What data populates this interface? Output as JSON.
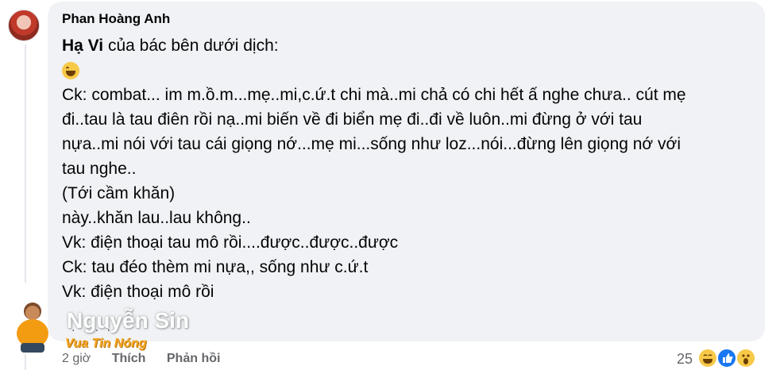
{
  "comment": {
    "author": "Phan Hoàng Anh",
    "mention": "Hạ Vi",
    "intro_rest": " của bác bên dưới dịch:",
    "emoji": "haha-emoji",
    "lines": [
      "Ck: combat... im m.ồ.m...mẹ..mi,c.ứ.t chi mà..mi chả có chi hết ấ nghe chưa.. cút mẹ",
      "đi..tau là tau điên rồi nạ..mi biến về đi biển mẹ đi..đi về luôn..mi đừng ở với tau",
      "nựa..mi nói với tau cái giọng nớ...mẹ mi...sống như loz...nói...đừng lên giọng nớ với",
      "tau nghe..",
      "(Tới cầm khăn)",
      "này..khăn lau..lau không..",
      "Vk: điện thoại tau mô rồi....được..được..được",
      "Ck: tau đéo thèm mi nựa,, sống như c.ứ.t",
      "Vk: điện thoại mô rồi"
    ],
    "trailing": ". . . ."
  },
  "actions": {
    "time": "2 giờ",
    "like": "Thích",
    "reply": "Phản hồi"
  },
  "reactions": {
    "count": "25",
    "types": [
      "haha",
      "like",
      "wow"
    ]
  },
  "watermark": {
    "name": "Nguyễn Sin",
    "tagline": "Vua Tin Nóng"
  }
}
